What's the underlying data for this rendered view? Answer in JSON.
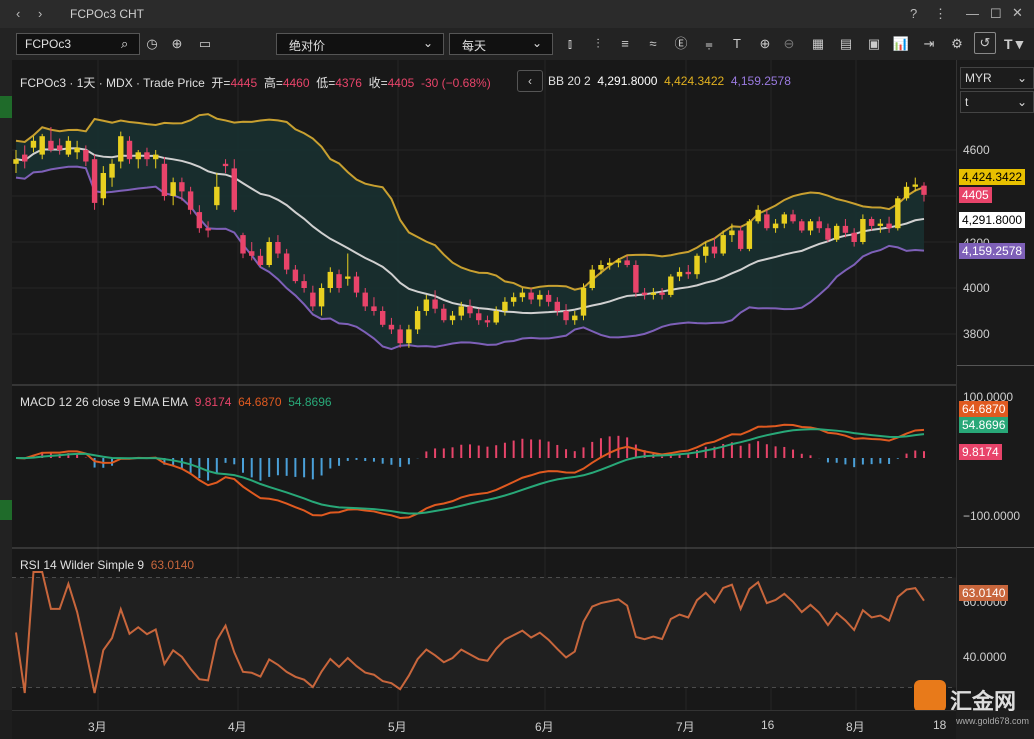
{
  "window": {
    "title": "FCPOc3 CHT"
  },
  "toolbar": {
    "symbol": "FCPOc3",
    "price_mode": "绝对价",
    "interval": "每天"
  },
  "main_legend": {
    "symbol": "FCPOc3",
    "period": "1天",
    "exchange": "MDX",
    "source": "Trade Price",
    "open_label": "开=",
    "open": "4445",
    "high_label": "高=",
    "high": "4460",
    "low_label": "低=",
    "low": "4376",
    "close_label": "收=",
    "close": "4405",
    "change": "-30 (−0.68%)",
    "bb_label": "BB 20 2",
    "bb_mid": "4,291.8000",
    "bb_upper": "4,424.3422",
    "bb_lower": "4,159.2578"
  },
  "currency": "MYR",
  "unit": "t",
  "price_axis": {
    "ticks": [
      "4600",
      "4400",
      "4200",
      "4000",
      "3800"
    ],
    "tags": {
      "upper": "4,424.3422",
      "last": "4405",
      "mid": "4,291.8000",
      "lower": "4,159.2578"
    }
  },
  "macd_legend": {
    "label": "MACD 12 26 close 9 EMA EMA",
    "hist": "9.8174",
    "macd": "64.6870",
    "signal": "54.8696"
  },
  "macd_axis": {
    "ticks": [
      "100.0000",
      "−100.0000"
    ]
  },
  "rsi_legend": {
    "label": "RSI 14 Wilder Simple 9",
    "value": "63.0140"
  },
  "rsi_axis": {
    "ticks": [
      "60.0000",
      "40.0000"
    ]
  },
  "x_axis": {
    "labels": [
      "3月",
      "4月",
      "5月",
      "6月",
      "7月",
      "16",
      "8月",
      "18"
    ]
  },
  "watermark": {
    "text": "汇金网",
    "sub": "www.gold678.com"
  },
  "colors": {
    "up": "#e8d020",
    "down": "#e8446a",
    "bb": "#c8a030",
    "bblower": "#7e60b8",
    "mid": "#d0d0d0",
    "macd": "#e05a20",
    "signal": "#28a878",
    "rsi": "#c8663c"
  },
  "chart_data": {
    "type": "candlestick",
    "ylim": [
      3700,
      4700
    ],
    "candles": [
      {
        "o": 4540,
        "h": 4600,
        "l": 4500,
        "c": 4560
      },
      {
        "o": 4580,
        "h": 4620,
        "l": 4520,
        "c": 4550
      },
      {
        "o": 4610,
        "h": 4660,
        "l": 4590,
        "c": 4640
      },
      {
        "o": 4580,
        "h": 4670,
        "l": 4560,
        "c": 4660
      },
      {
        "o": 4640,
        "h": 4700,
        "l": 4590,
        "c": 4600
      },
      {
        "o": 4620,
        "h": 4650,
        "l": 4580,
        "c": 4600
      },
      {
        "o": 4580,
        "h": 4660,
        "l": 4570,
        "c": 4640
      },
      {
        "o": 4590,
        "h": 4640,
        "l": 4560,
        "c": 4610
      },
      {
        "o": 4600,
        "h": 4620,
        "l": 4530,
        "c": 4550
      },
      {
        "o": 4560,
        "h": 4580,
        "l": 4340,
        "c": 4370
      },
      {
        "o": 4390,
        "h": 4530,
        "l": 4360,
        "c": 4500
      },
      {
        "o": 4480,
        "h": 4560,
        "l": 4440,
        "c": 4540
      },
      {
        "o": 4550,
        "h": 4680,
        "l": 4520,
        "c": 4660
      },
      {
        "o": 4640,
        "h": 4660,
        "l": 4540,
        "c": 4560
      },
      {
        "o": 4560,
        "h": 4600,
        "l": 4520,
        "c": 4590
      },
      {
        "o": 4590,
        "h": 4610,
        "l": 4530,
        "c": 4560
      },
      {
        "o": 4560,
        "h": 4600,
        "l": 4520,
        "c": 4580
      },
      {
        "o": 4540,
        "h": 4570,
        "l": 4380,
        "c": 4400
      },
      {
        "o": 4400,
        "h": 4480,
        "l": 4360,
        "c": 4460
      },
      {
        "o": 4460,
        "h": 4480,
        "l": 4380,
        "c": 4420
      },
      {
        "o": 4420,
        "h": 4440,
        "l": 4320,
        "c": 4340
      },
      {
        "o": 4330,
        "h": 4360,
        "l": 4240,
        "c": 4260
      },
      {
        "o": 4260,
        "h": 4290,
        "l": 4220,
        "c": 4250
      },
      {
        "o": 4360,
        "h": 4500,
        "l": 4340,
        "c": 4440
      },
      {
        "o": 4540,
        "h": 4560,
        "l": 4500,
        "c": 4530
      },
      {
        "o": 4520,
        "h": 4560,
        "l": 4330,
        "c": 4340
      },
      {
        "o": 4230,
        "h": 4240,
        "l": 4130,
        "c": 4150
      },
      {
        "o": 4160,
        "h": 4200,
        "l": 4120,
        "c": 4140
      },
      {
        "o": 4140,
        "h": 4170,
        "l": 4090,
        "c": 4100
      },
      {
        "o": 4100,
        "h": 4220,
        "l": 4090,
        "c": 4200
      },
      {
        "o": 4200,
        "h": 4230,
        "l": 4130,
        "c": 4150
      },
      {
        "o": 4150,
        "h": 4170,
        "l": 4060,
        "c": 4080
      },
      {
        "o": 4080,
        "h": 4100,
        "l": 4020,
        "c": 4030
      },
      {
        "o": 4030,
        "h": 4060,
        "l": 3980,
        "c": 4000
      },
      {
        "o": 3980,
        "h": 4010,
        "l": 3900,
        "c": 3920
      },
      {
        "o": 3920,
        "h": 4020,
        "l": 3880,
        "c": 4000
      },
      {
        "o": 4000,
        "h": 4090,
        "l": 3980,
        "c": 4070
      },
      {
        "o": 4060,
        "h": 4080,
        "l": 3980,
        "c": 4000
      },
      {
        "o": 4040,
        "h": 4150,
        "l": 4010,
        "c": 4050
      },
      {
        "o": 4050,
        "h": 4070,
        "l": 3960,
        "c": 3980
      },
      {
        "o": 3980,
        "h": 4000,
        "l": 3900,
        "c": 3920
      },
      {
        "o": 3920,
        "h": 3960,
        "l": 3880,
        "c": 3900
      },
      {
        "o": 3900,
        "h": 3920,
        "l": 3830,
        "c": 3840
      },
      {
        "o": 3840,
        "h": 3870,
        "l": 3800,
        "c": 3820
      },
      {
        "o": 3820,
        "h": 3840,
        "l": 3740,
        "c": 3760
      },
      {
        "o": 3760,
        "h": 3840,
        "l": 3740,
        "c": 3820
      },
      {
        "o": 3820,
        "h": 3920,
        "l": 3800,
        "c": 3900
      },
      {
        "o": 3900,
        "h": 3970,
        "l": 3880,
        "c": 3950
      },
      {
        "o": 3950,
        "h": 3990,
        "l": 3890,
        "c": 3910
      },
      {
        "o": 3910,
        "h": 3930,
        "l": 3850,
        "c": 3860
      },
      {
        "o": 3860,
        "h": 3900,
        "l": 3840,
        "c": 3880
      },
      {
        "o": 3880,
        "h": 3940,
        "l": 3860,
        "c": 3920
      },
      {
        "o": 3920,
        "h": 3950,
        "l": 3870,
        "c": 3890
      },
      {
        "o": 3890,
        "h": 3910,
        "l": 3840,
        "c": 3860
      },
      {
        "o": 3860,
        "h": 3880,
        "l": 3830,
        "c": 3850
      },
      {
        "o": 3850,
        "h": 3920,
        "l": 3840,
        "c": 3900
      },
      {
        "o": 3900,
        "h": 3960,
        "l": 3880,
        "c": 3940
      },
      {
        "o": 3940,
        "h": 3980,
        "l": 3920,
        "c": 3960
      },
      {
        "o": 3960,
        "h": 4000,
        "l": 3940,
        "c": 3980
      },
      {
        "o": 3980,
        "h": 4000,
        "l": 3930,
        "c": 3950
      },
      {
        "o": 3950,
        "h": 3990,
        "l": 3920,
        "c": 3970
      },
      {
        "o": 3970,
        "h": 3990,
        "l": 3920,
        "c": 3940
      },
      {
        "o": 3940,
        "h": 3960,
        "l": 3880,
        "c": 3900
      },
      {
        "o": 3900,
        "h": 3930,
        "l": 3840,
        "c": 3860
      },
      {
        "o": 3860,
        "h": 3900,
        "l": 3840,
        "c": 3880
      },
      {
        "o": 3880,
        "h": 4020,
        "l": 3860,
        "c": 4000
      },
      {
        "o": 4000,
        "h": 4100,
        "l": 3990,
        "c": 4080
      },
      {
        "o": 4080,
        "h": 4120,
        "l": 4060,
        "c": 4100
      },
      {
        "o": 4100,
        "h": 4130,
        "l": 4080,
        "c": 4110
      },
      {
        "o": 4110,
        "h": 4130,
        "l": 4090,
        "c": 4120
      },
      {
        "o": 4120,
        "h": 4140,
        "l": 4090,
        "c": 4100
      },
      {
        "o": 4100,
        "h": 4120,
        "l": 3960,
        "c": 3980
      },
      {
        "o": 3980,
        "h": 4000,
        "l": 3950,
        "c": 3970
      },
      {
        "o": 3970,
        "h": 4000,
        "l": 3950,
        "c": 3980
      },
      {
        "o": 3980,
        "h": 4000,
        "l": 3950,
        "c": 3970
      },
      {
        "o": 3970,
        "h": 4060,
        "l": 3960,
        "c": 4050
      },
      {
        "o": 4050,
        "h": 4090,
        "l": 4030,
        "c": 4070
      },
      {
        "o": 4070,
        "h": 4100,
        "l": 4040,
        "c": 4060
      },
      {
        "o": 4060,
        "h": 4150,
        "l": 4040,
        "c": 4140
      },
      {
        "o": 4140,
        "h": 4200,
        "l": 4110,
        "c": 4180
      },
      {
        "o": 4180,
        "h": 4220,
        "l": 4130,
        "c": 4150
      },
      {
        "o": 4150,
        "h": 4250,
        "l": 4140,
        "c": 4230
      },
      {
        "o": 4230,
        "h": 4280,
        "l": 4200,
        "c": 4250
      },
      {
        "o": 4250,
        "h": 4270,
        "l": 4160,
        "c": 4170
      },
      {
        "o": 4170,
        "h": 4300,
        "l": 4160,
        "c": 4290
      },
      {
        "o": 4290,
        "h": 4360,
        "l": 4280,
        "c": 4340
      },
      {
        "o": 4320,
        "h": 4340,
        "l": 4250,
        "c": 4260
      },
      {
        "o": 4260,
        "h": 4300,
        "l": 4240,
        "c": 4280
      },
      {
        "o": 4280,
        "h": 4330,
        "l": 4260,
        "c": 4320
      },
      {
        "o": 4320,
        "h": 4340,
        "l": 4280,
        "c": 4290
      },
      {
        "o": 4290,
        "h": 4300,
        "l": 4240,
        "c": 4250
      },
      {
        "o": 4250,
        "h": 4300,
        "l": 4230,
        "c": 4290
      },
      {
        "o": 4290,
        "h": 4310,
        "l": 4240,
        "c": 4260
      },
      {
        "o": 4260,
        "h": 4280,
        "l": 4200,
        "c": 4210
      },
      {
        "o": 4210,
        "h": 4280,
        "l": 4200,
        "c": 4270
      },
      {
        "o": 4270,
        "h": 4300,
        "l": 4220,
        "c": 4240
      },
      {
        "o": 4240,
        "h": 4260,
        "l": 4180,
        "c": 4200
      },
      {
        "o": 4200,
        "h": 4320,
        "l": 4190,
        "c": 4300
      },
      {
        "o": 4300,
        "h": 4310,
        "l": 4250,
        "c": 4270
      },
      {
        "o": 4270,
        "h": 4300,
        "l": 4240,
        "c": 4280
      },
      {
        "o": 4280,
        "h": 4310,
        "l": 4240,
        "c": 4260
      },
      {
        "o": 4260,
        "h": 4400,
        "l": 4250,
        "c": 4390
      },
      {
        "o": 4390,
        "h": 4460,
        "l": 4380,
        "c": 4440
      },
      {
        "o": 4440,
        "h": 4480,
        "l": 4420,
        "c": 4450
      },
      {
        "o": 4445,
        "h": 4460,
        "l": 4376,
        "c": 4405
      }
    ]
  }
}
